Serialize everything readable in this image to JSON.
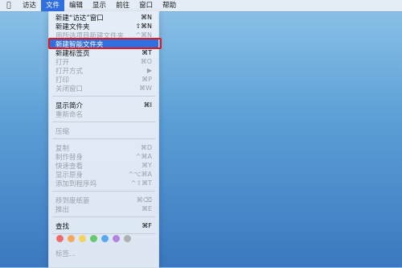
{
  "menubar": {
    "apple_icon": "apple-logo-icon",
    "items": [
      {
        "label": "访达"
      },
      {
        "label": "文件"
      },
      {
        "label": "编辑"
      },
      {
        "label": "显示"
      },
      {
        "label": "前往"
      },
      {
        "label": "窗口"
      },
      {
        "label": "帮助"
      }
    ]
  },
  "file_menu": {
    "items": [
      {
        "label": "新建“访达”窗口",
        "shortcut": "⌘N"
      },
      {
        "label": "新建文件夹",
        "shortcut": "⇧⌘N"
      },
      {
        "label": "用所选项目新建文件夹",
        "shortcut": "^⌘N"
      },
      {
        "label": "新建智能文件夹",
        "shortcut": ""
      },
      {
        "label": "新建标签页",
        "shortcut": "⌘T"
      },
      {
        "label": "打开",
        "shortcut": "⌘O"
      },
      {
        "label": "打开方式",
        "shortcut": "▶"
      },
      {
        "label": "打印",
        "shortcut": "⌘P"
      },
      {
        "label": "关闭窗口",
        "shortcut": "⌘W"
      },
      {
        "label": "显示简介",
        "shortcut": "⌘I"
      },
      {
        "label": "重新命名",
        "shortcut": ""
      },
      {
        "label": "压缩",
        "shortcut": ""
      },
      {
        "label": "复制",
        "shortcut": "⌘D"
      },
      {
        "label": "制作替身",
        "shortcut": "^⌘A"
      },
      {
        "label": "快速查看",
        "shortcut": "⌘Y"
      },
      {
        "label": "显示原身",
        "shortcut": "^⌥⌘A"
      },
      {
        "label": "添加到程序坞",
        "shortcut": "^⇧⌘T"
      },
      {
        "label": "移到废纸篓",
        "shortcut": "⌘⌫"
      },
      {
        "label": "推出",
        "shortcut": "⌘E"
      },
      {
        "label": "查找",
        "shortcut": "⌘F"
      },
      {
        "label": "标签...",
        "shortcut": ""
      }
    ],
    "tag_colors": [
      "#f06a6a",
      "#f6a85a",
      "#f4d35e",
      "#67c96b",
      "#5aa7ef",
      "#b483dd",
      "#b0b0b0"
    ]
  },
  "annotation": {
    "color": "#e2191f"
  }
}
